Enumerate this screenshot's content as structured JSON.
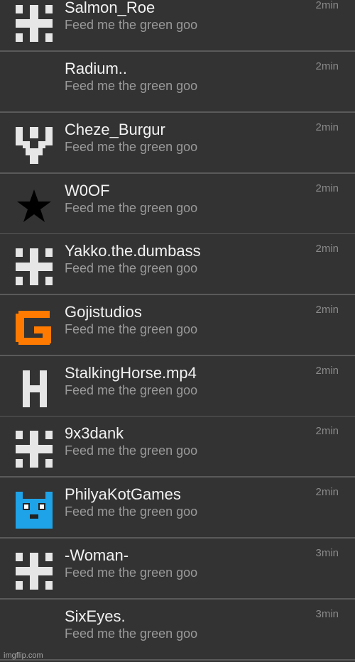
{
  "conversations": [
    {
      "username": "Salmon_Roe",
      "message": "Feed me the green goo",
      "time": "2min",
      "avatar_icon": "hash-grid-icon"
    },
    {
      "username": "Radium..",
      "message": "Feed me the green goo",
      "time": "2min",
      "avatar_icon": "none"
    },
    {
      "username": "Cheze_Burgur",
      "message": "Feed me the green goo",
      "time": "2min",
      "avatar_icon": "pixel-v-icon"
    },
    {
      "username": "W0OF",
      "message": "Feed me the green goo",
      "time": "2min",
      "avatar_icon": "star-icon"
    },
    {
      "username": "Yakko.the.dumbass",
      "message": "Feed me the green goo",
      "time": "2min",
      "avatar_icon": "hash-grid-icon"
    },
    {
      "username": "Gojistudios",
      "message": "Feed me the green goo",
      "time": "2min",
      "avatar_icon": "pixel-g-icon"
    },
    {
      "username": "StalkingHorse.mp4",
      "message": "Feed me the green goo",
      "time": "2min",
      "avatar_icon": "letter-h-icon"
    },
    {
      "username": "9x3dank",
      "message": "Feed me the green goo",
      "time": "2min",
      "avatar_icon": "hash-grid-icon"
    },
    {
      "username": "PhilyaKotGames",
      "message": "Feed me the green goo",
      "time": "2min",
      "avatar_icon": "pixel-cat-icon"
    },
    {
      "username": "-Woman-",
      "message": "Feed me the green goo",
      "time": "3min",
      "avatar_icon": "hash-grid-icon"
    },
    {
      "username": "SixEyes.",
      "message": "Feed me the green goo",
      "time": "3min",
      "avatar_icon": "none"
    }
  ],
  "colors": {
    "background": "#333333",
    "divider": "#5a5a5a",
    "username": "#f2f2f2",
    "message": "#9a9a9a",
    "time": "#8a8a8a",
    "hash_icon": "#e6e6e6",
    "star_icon": "#000000",
    "pixel_g_icon": "#ff7a00",
    "pixel_cat_icon": "#1fa3e8"
  },
  "watermark": "imgflip.com"
}
